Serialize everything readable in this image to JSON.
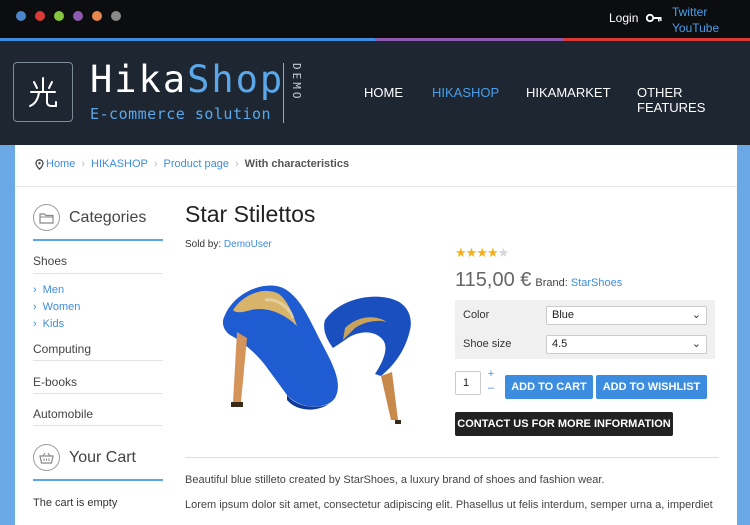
{
  "topbar": {
    "dot_colors": [
      "#4a86c9",
      "#d93a37",
      "#86c440",
      "#8e5ab0",
      "#e6874e",
      "#8a8a8a"
    ],
    "login_label": "Login",
    "key_icon": "key-icon",
    "social": [
      "Twitter",
      "YouTube"
    ]
  },
  "stripe_colors": [
    "#3c8de0",
    "#3c8de0",
    "#8e5ab0",
    "#d93a37"
  ],
  "header": {
    "logo_icon": "logo-glyph-icon",
    "logo_part1": "Hika",
    "logo_part2": "Shop",
    "tagline": "E-commerce solution",
    "demo": "DEMO",
    "nav": [
      "HOME",
      "HIKASHOP",
      "HIKAMARKET",
      "OTHER FEATURES"
    ],
    "active_nav": "HIKASHOP",
    "accent_color": "#4a9eea"
  },
  "breadcrumb": {
    "items": [
      "Home",
      "HIKASHOP",
      "Product page"
    ],
    "current": "With characteristics"
  },
  "sidebar": {
    "categories_title": "Categories",
    "categories_icon": "folder-icon",
    "shoes": "Shoes",
    "sub": [
      "Men",
      "Women",
      "Kids"
    ],
    "others": [
      "Computing",
      "E-books",
      "Automobile"
    ],
    "cart_title": "Your Cart",
    "cart_icon": "basket-icon",
    "cart_empty": "The cart is empty"
  },
  "product": {
    "title": "Star Stilettos",
    "sold_by_label": "Sold by:",
    "seller": "DemoUser",
    "rating": 4,
    "rating_max": 5,
    "price": "115,00 €",
    "brand_label": "Brand:",
    "brand": "StarShoes",
    "color_label": "Color",
    "color_value": "Blue",
    "size_label": "Shoe size",
    "size_value": "4.5",
    "qty": "1",
    "plus": "+",
    "minus": "–",
    "add_to_cart": "ADD TO CART",
    "add_to_wishlist": "ADD TO WISHLIST",
    "contact": "CONTACT US FOR MORE INFORMATION",
    "desc1": "Beautiful blue stilleto created by StarShoes, a luxury brand of shoes and fashion wear.",
    "desc2": "Lorem ipsum dolor sit amet, consectetur adipiscing elit. Phasellus ut felis interdum, semper urna a, imperdiet"
  }
}
